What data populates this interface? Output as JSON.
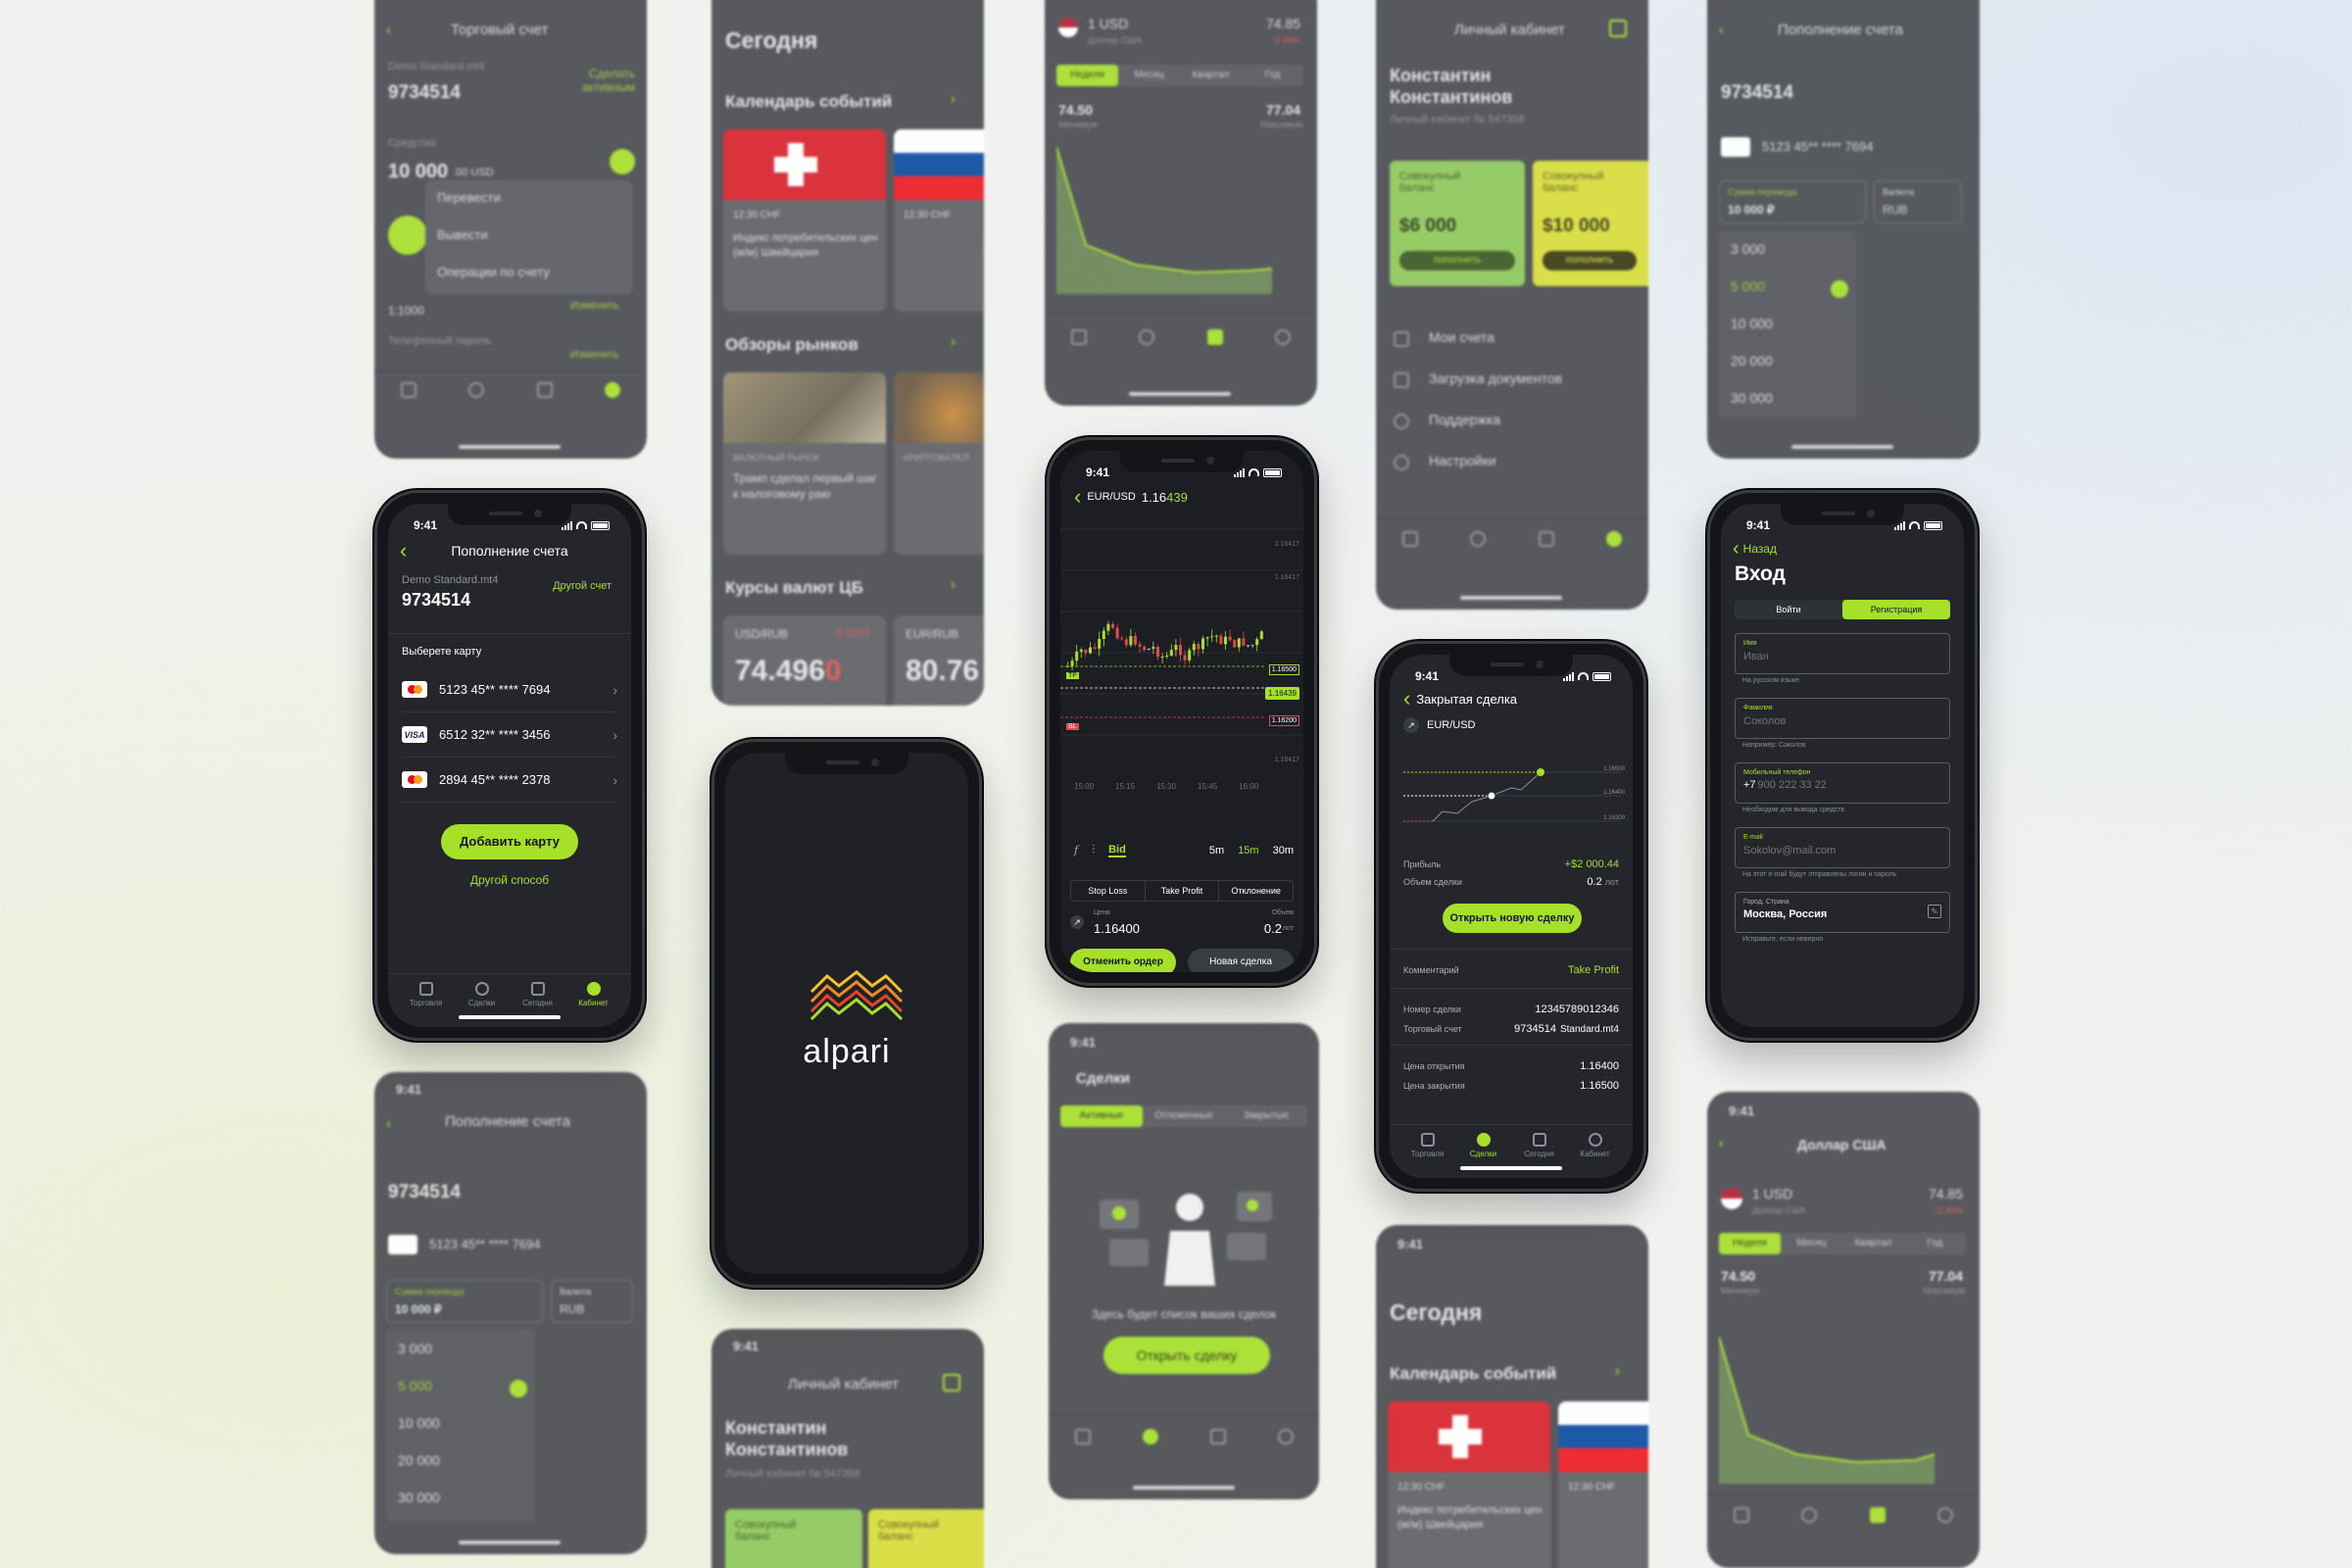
{
  "brand": {
    "name": "alpari",
    "colors": {
      "accent": "#a6e02b",
      "bg": "#24262c"
    }
  },
  "status": {
    "time": "9:41"
  },
  "tabs": {
    "trade": "Торговля",
    "deals": "Сделки",
    "today": "Сегодня",
    "cabinet": "Кабинет"
  },
  "deposit": {
    "title": "Пополнение счета",
    "account_type": "Demo Standard.mt4",
    "account_number": "9734514",
    "other_account": "Другой счет",
    "choose_card": "Выберете карту",
    "cards": [
      {
        "number": "5123 45** **** 7694",
        "brand": "mastercard"
      },
      {
        "number": "6512 32** **** 3456",
        "brand": "visa"
      },
      {
        "number": "2894 45** **** 2378",
        "brand": "mastercard"
      }
    ],
    "add_card": "Добавить карту",
    "other_method": "Другой способ"
  },
  "splash": {
    "logo": "alpari"
  },
  "chart": {
    "pair": "EUR/USD",
    "price_main": "1.16",
    "price_tail": "439",
    "times": [
      "15:00",
      "15:15",
      "15:30",
      "15:45",
      "16:00"
    ],
    "levels": [
      "1.16417",
      "1.16417",
      "1.16500",
      "1.16500",
      "1.16200",
      "1.16417"
    ],
    "current": "1.16439",
    "tp_label": "TP",
    "sl_label": "SL",
    "bid": "Bid",
    "timeframes": [
      "5m",
      "15m",
      "30m"
    ],
    "order_tabs": [
      "Stop Loss",
      "Take Profit",
      "Отклонение"
    ],
    "price_label": "Цена",
    "price_value": "1.16400",
    "volume_label": "Объем",
    "volume_value": "0.2",
    "volume_unit": "лот",
    "cancel_btn": "Отменить ордер",
    "new_btn": "Новая сделка"
  },
  "closed": {
    "back": "Закрытая сделка",
    "pair": "EUR/USD",
    "levels": [
      "1.16500",
      "1.16400",
      "1.16200"
    ],
    "profit_label": "Прибыль",
    "profit_value": "+$2 000.44",
    "volume_label": "Объем сделки",
    "volume_value": "0.2",
    "volume_unit": "лот",
    "open_new": "Открыть новую сделку",
    "comment_label": "Комментарий",
    "comment_value": "Take Profit",
    "deal_no_label": "Номер сделки",
    "deal_no_value": "12345789012346",
    "account_label": "Торговый счет",
    "account_value": "9734514",
    "account_type": "Standard.mt4",
    "open_price_label": "Цена открытия",
    "open_price_value": "1.16400",
    "close_price_label": "Цена закрытия",
    "close_price_value": "1.16500"
  },
  "login": {
    "back": "Назад",
    "title": "Вход",
    "tab_login": "Войти",
    "tab_register": "Регистрация",
    "fields": [
      {
        "label": "Имя",
        "placeholder": "Иван",
        "hint": "На русском языке",
        "value": ""
      },
      {
        "label": "Фамилия",
        "placeholder": "Соколов",
        "hint": "Например: Соколов",
        "value": ""
      },
      {
        "label": "Мобильный телефон",
        "placeholder": "900 222 33 22",
        "hint": "Необходим для вывода средств",
        "value": "+7"
      },
      {
        "label": "E-mail",
        "placeholder": "Sokolov@mail.com",
        "hint": "На этот e-mail будут отправлены логин и пароль",
        "value": ""
      },
      {
        "label": "Город, Страна",
        "placeholder": "",
        "hint": "Исправьте, если неверно",
        "value": "Москва, Россия"
      }
    ]
  },
  "bg": {
    "trade_account": {
      "title": "Торговый счет",
      "acc_type": "Demo Standard.mt4",
      "number": "9734514",
      "make_active": "Сделать активным",
      "funds": "Средства",
      "amount": "10 000",
      "cents": ".00 USD",
      "menu": [
        "Перевести",
        "Вывести",
        "Операции по счету"
      ],
      "leverage": "1:1000",
      "phone_pwd": "Телефонный пароль",
      "change": "Изменить"
    },
    "today": {
      "title": "Сегодня",
      "calendar": "Календарь событий",
      "event_time": "12:30 CHF",
      "event_text": "Индекс потребительских цен (м/м) Швейцария",
      "reviews": "Обзоры рынков",
      "review_tag1": "ВАЛЮТНЫЙ РЫНОК",
      "review_text1": "Трамп сделал первый шаг к налоговому раю",
      "review_tag2": "КРИПТОВАЛЮТ",
      "rates": "Курсы валют ЦБ",
      "pair1": "USD/RUB",
      "delta1": "-0.2203",
      "rate1": "74.496",
      "rate1_tail": "0",
      "pair2": "EUR/RUB",
      "rate2": "80.76"
    },
    "usd": {
      "title": "Доллар США",
      "unit": "1 USD",
      "sub": "Доллар США",
      "rate": "74.85",
      "delta": "-2.45%",
      "periods": [
        "Неделя",
        "Месяц",
        "Квартал",
        "Год"
      ],
      "min": "74.50",
      "min_label": "Минимум",
      "max": "77.04",
      "max_label": "Максимум"
    },
    "cabinet": {
      "title": "Личный кабинет",
      "name": "Константин Константинов",
      "acc_label": "Личный кабинет № 547358",
      "total_label": "Совокупный баланс",
      "bal1": "$6 000",
      "bal2": "$10 000",
      "topup": "пополнить",
      "menu": [
        "Мои счета",
        "Загрузка документов",
        "Поддержка",
        "Настройки"
      ]
    },
    "deals": {
      "title": "Сделки",
      "tabs": [
        "Активные",
        "Отложенные",
        "Закрытые"
      ],
      "empty": "Здесь будет список ваших сделок",
      "open": "Открыть сделку"
    },
    "deposit2": {
      "title": "Пополнение счета",
      "number": "9734514",
      "card": "5123 45** **** 7694",
      "sum_label": "Сумма перевода",
      "sum": "10 000 ₽",
      "cur_label": "Валюта",
      "cur": "RUB",
      "options": [
        "3 000",
        "5 000",
        "10 000",
        "20 000",
        "30 000"
      ]
    }
  }
}
